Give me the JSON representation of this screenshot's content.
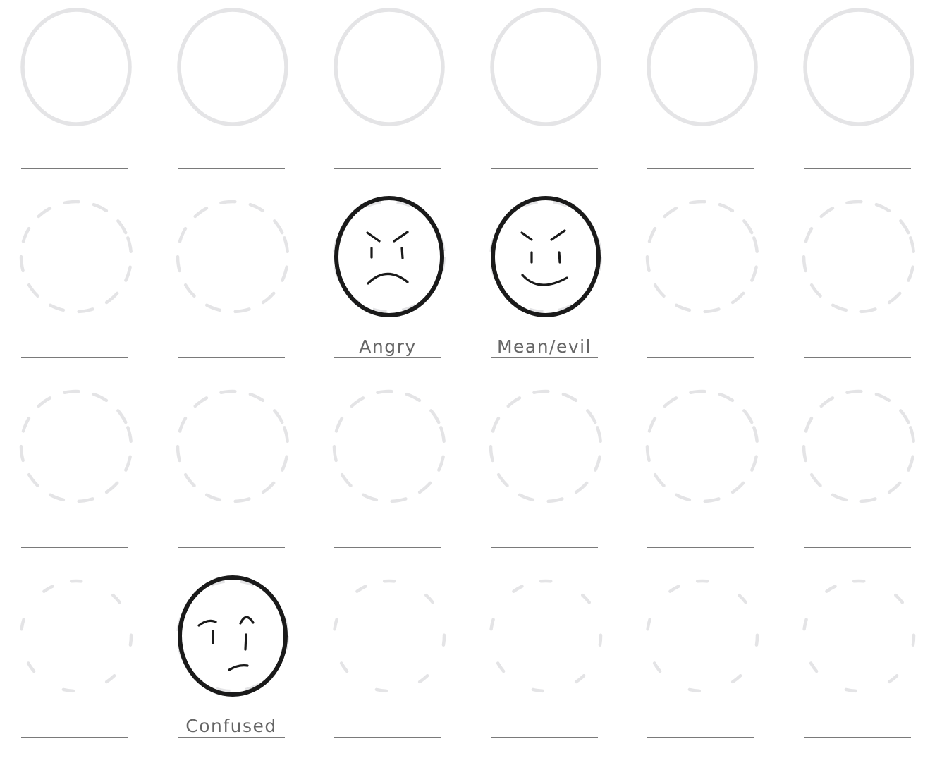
{
  "worksheet": {
    "rows": [
      {
        "cells": [
          {
            "style": "solid-blank",
            "label": ""
          },
          {
            "style": "solid-blank",
            "label": ""
          },
          {
            "style": "solid-blank",
            "label": ""
          },
          {
            "style": "solid-blank",
            "label": ""
          },
          {
            "style": "solid-blank",
            "label": ""
          },
          {
            "style": "solid-blank",
            "label": ""
          }
        ]
      },
      {
        "cells": [
          {
            "style": "dashed-blank",
            "label": ""
          },
          {
            "style": "dashed-blank",
            "label": ""
          },
          {
            "style": "drawn",
            "expression": "angry",
            "label": "Angry"
          },
          {
            "style": "drawn",
            "expression": "mean-evil",
            "label": "Mean/evil"
          },
          {
            "style": "dashed-blank",
            "label": ""
          },
          {
            "style": "dashed-blank",
            "label": ""
          }
        ]
      },
      {
        "cells": [
          {
            "style": "dashed-blank",
            "label": ""
          },
          {
            "style": "dashed-blank",
            "label": ""
          },
          {
            "style": "dashed-blank",
            "label": ""
          },
          {
            "style": "dashed-blank",
            "label": ""
          },
          {
            "style": "dashed-blank",
            "label": ""
          },
          {
            "style": "dashed-blank",
            "label": ""
          }
        ]
      },
      {
        "cells": [
          {
            "style": "sparse-dashed-blank",
            "label": ""
          },
          {
            "style": "drawn",
            "expression": "confused",
            "label": "Confused"
          },
          {
            "style": "sparse-dashed-blank",
            "label": ""
          },
          {
            "style": "sparse-dashed-blank",
            "label": ""
          },
          {
            "style": "sparse-dashed-blank",
            "label": ""
          },
          {
            "style": "sparse-dashed-blank",
            "label": ""
          }
        ]
      }
    ]
  },
  "colors": {
    "ink": "#1a1a1a",
    "guide": "#e4e4e6",
    "line": "#7a7a7a",
    "caption": "#666666"
  }
}
